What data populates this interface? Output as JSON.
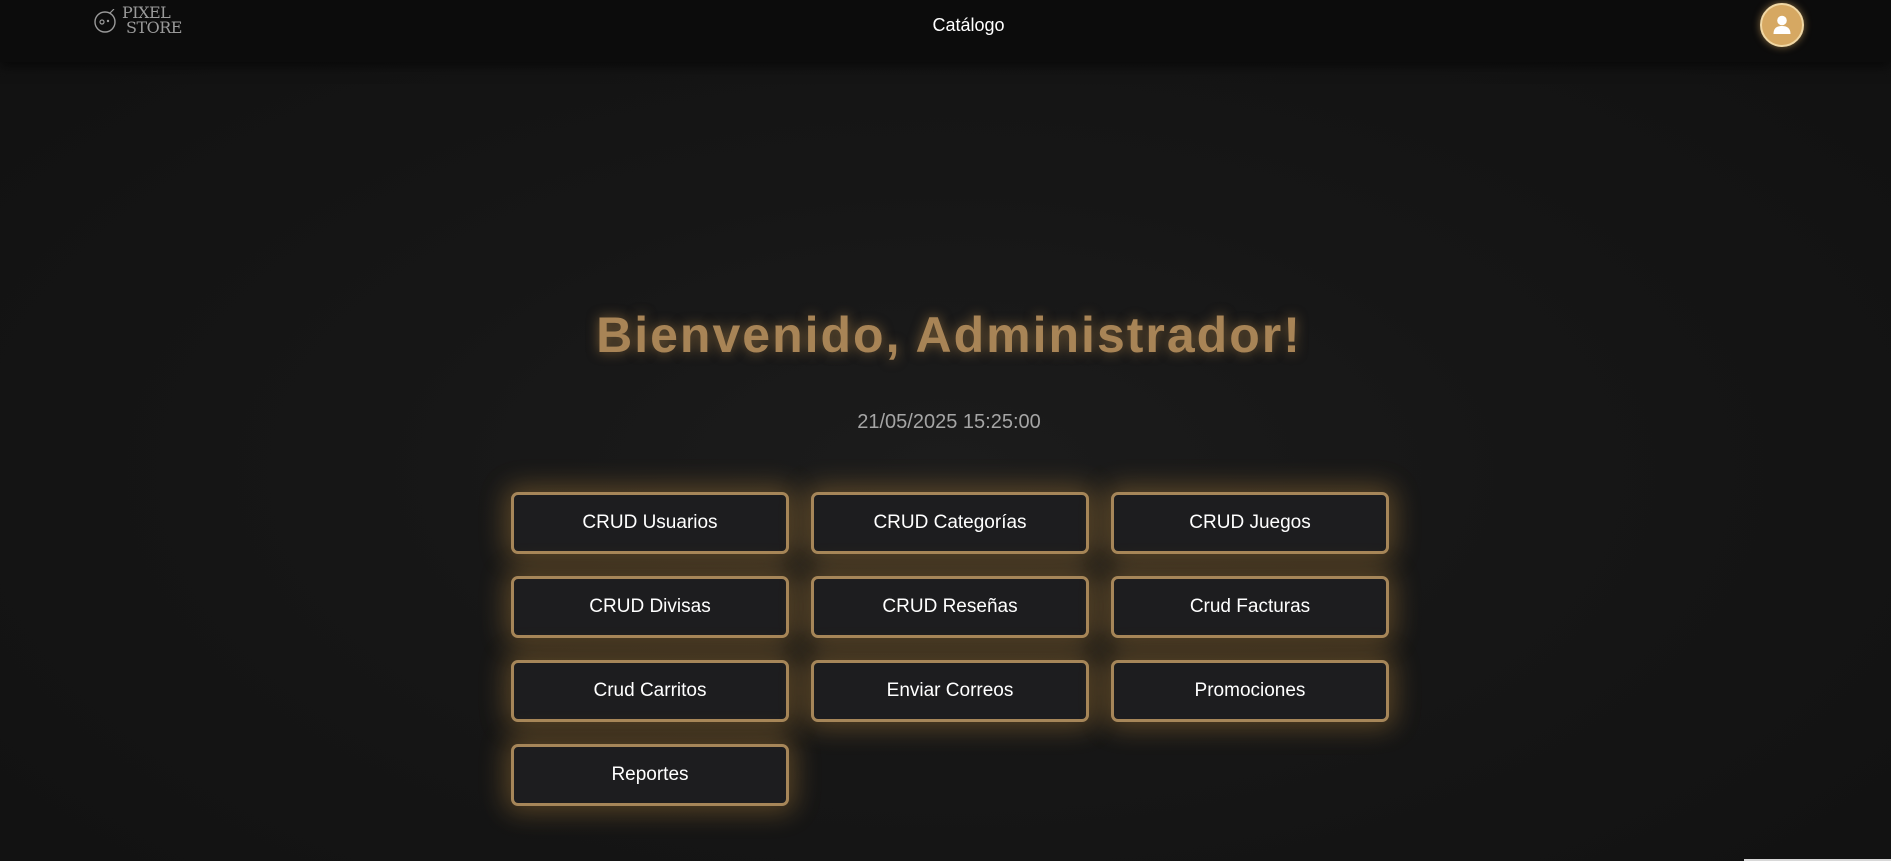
{
  "header": {
    "logo_text_line1": "PIXEL",
    "logo_text_line2": "STORE",
    "nav_link": "Catálogo",
    "avatar_icon": "user-icon"
  },
  "main": {
    "welcome": "Bienvenido, Administrador!",
    "datetime": "21/05/2025 15:25:00",
    "buttons": [
      {
        "label": "CRUD Usuarios"
      },
      {
        "label": "CRUD Categorías"
      },
      {
        "label": "CRUD Juegos"
      },
      {
        "label": "CRUD Divisas"
      },
      {
        "label": "CRUD Reseñas"
      },
      {
        "label": "Crud Facturas"
      },
      {
        "label": "Crud Carritos"
      },
      {
        "label": "Enviar Correos"
      },
      {
        "label": "Promociones"
      },
      {
        "label": "Reportes"
      }
    ]
  },
  "colors": {
    "accent": "#a68659",
    "avatar_bg": "#d6a862",
    "background": "#141414",
    "button_bg": "#1d1d1f"
  }
}
